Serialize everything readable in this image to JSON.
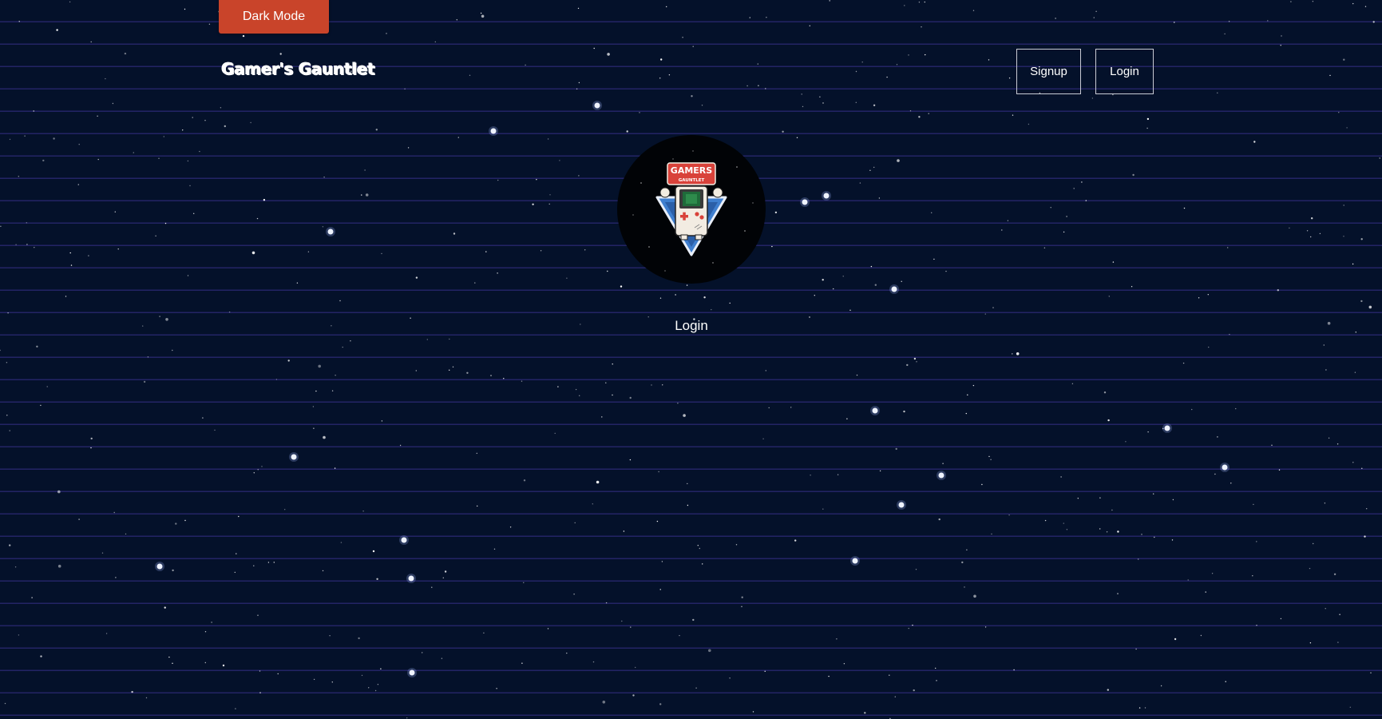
{
  "header": {
    "theme_toggle_label": "Dark Mode",
    "brand_title": "Gamer's Gauntlet",
    "nav": {
      "signup_label": "Signup",
      "login_label": "Login"
    }
  },
  "logo": {
    "badge_top": "GAMERS",
    "badge_sub": "GAUNTLET"
  },
  "main": {
    "title": "Login"
  },
  "colors": {
    "background": "#04112a",
    "accent": "#c9442a",
    "grid_lines": "#3c3496",
    "text": "#ffffff"
  },
  "icons": {
    "logo": "gameboy-badge-icon",
    "background": "starfield"
  }
}
